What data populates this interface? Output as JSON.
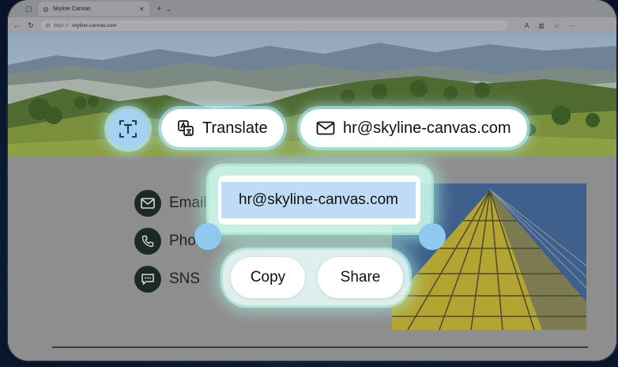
{
  "browser": {
    "tab_title": "Skyline Canvas",
    "tab_close": "✕",
    "new_tab": "+",
    "tab_menu": "⌄",
    "url_protocol": "https://",
    "url_domain": "skyline-canvas.com"
  },
  "page": {
    "contacts": [
      {
        "label": "Email",
        "icon": "mail-icon"
      },
      {
        "label": "Phone",
        "icon": "phone-icon"
      },
      {
        "label": "SNS",
        "icon": "chat-icon"
      }
    ]
  },
  "overlay": {
    "text_tool_icon": "text-extract-icon",
    "translate_label": "Translate",
    "email_chip_label": "hr@skyline-canvas.com",
    "selected_text": "hr@skyline-canvas.com",
    "copy_label": "Copy",
    "share_label": "Share"
  },
  "colors": {
    "selection_highlight": "#bedcf6",
    "glow": "#aaf0ff",
    "icon_circle": "#1c2a24"
  }
}
